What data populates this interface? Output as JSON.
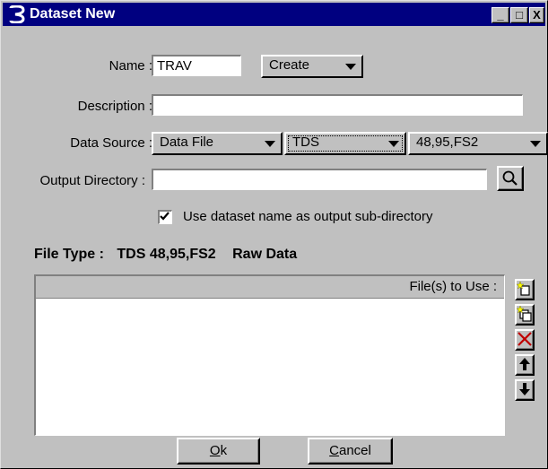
{
  "window": {
    "title": "Dataset New",
    "minimize": "_",
    "maximize": "□",
    "close": "X"
  },
  "form": {
    "name_label": "Name :",
    "name_value": "TRAV",
    "mode_value": "Create",
    "description_label": "Description :",
    "description_value": "",
    "data_source_label": "Data Source :",
    "data_source_value": "Data File",
    "format_value": "TDS",
    "version_value": "48,95,FS2",
    "output_dir_label": "Output Directory :",
    "output_dir_value": "",
    "subdir_checkbox_label": "Use dataset name as output sub-directory",
    "subdir_checked": true
  },
  "file_type": {
    "label": "File Type :",
    "value": "TDS 48,95,FS2",
    "kind": "Raw Data"
  },
  "files_list": {
    "header": "File(s) to Use :",
    "items": []
  },
  "side_icons": [
    "new-file-icon",
    "copy-file-icon",
    "delete-x-icon",
    "move-up-icon",
    "move-down-icon"
  ],
  "buttons": {
    "ok_mnemonic": "O",
    "ok_rest": "k",
    "cancel_mnemonic": "C",
    "cancel_rest": "ancel"
  },
  "colors": {
    "titlebar": "#000080",
    "face": "#c0c0c0",
    "delete": "#c00000",
    "new_icon": "#ffff00"
  }
}
